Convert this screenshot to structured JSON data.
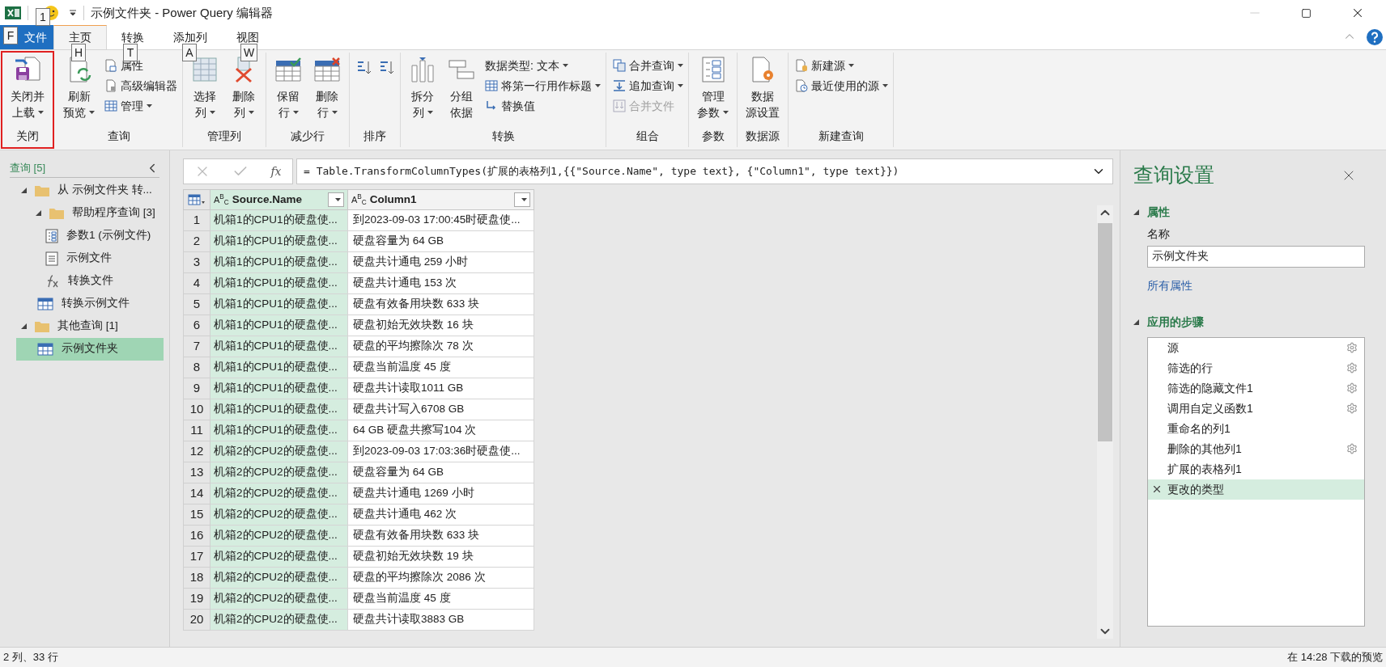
{
  "window": {
    "title": "示例文件夹 - Power Query 编辑器"
  },
  "keytips": [
    {
      "label": "1",
      "kind": "qat"
    },
    {
      "label": "F",
      "kind": "file"
    },
    {
      "label": "H",
      "kind": "home"
    },
    {
      "label": "T",
      "kind": "transform"
    },
    {
      "label": "A",
      "kind": "addcol"
    },
    {
      "label": "W",
      "kind": "view"
    }
  ],
  "tabs": [
    {
      "label": "文件",
      "kind": "file",
      "selected": false
    },
    {
      "label": "主页",
      "kind": "tab",
      "selected": true
    },
    {
      "label": "转换",
      "kind": "tab",
      "selected": false
    },
    {
      "label": "添加列",
      "kind": "tab",
      "selected": false
    },
    {
      "label": "视图",
      "kind": "tab",
      "selected": false
    }
  ],
  "ribbon": [
    {
      "label": "关闭",
      "highlighted": true,
      "items": [
        {
          "kind": "large",
          "lines": [
            "关闭并",
            "上载"
          ],
          "dropdown": true
        }
      ]
    },
    {
      "label": "查询",
      "highlighted": false,
      "items": [
        {
          "kind": "large",
          "lines": [
            "刷新",
            "预览"
          ],
          "dropdown": true
        },
        {
          "kind": "small",
          "label": "属性",
          "dropdown": false,
          "disabled": false
        },
        {
          "kind": "small",
          "label": "高级编辑器",
          "dropdown": false,
          "disabled": false
        },
        {
          "kind": "small",
          "label": "管理",
          "dropdown": true,
          "disabled": false
        }
      ]
    },
    {
      "label": "管理列",
      "highlighted": false,
      "items": [
        {
          "kind": "large",
          "lines": [
            "选择",
            "列"
          ],
          "dropdown": true
        },
        {
          "kind": "large",
          "lines": [
            "删除",
            "列"
          ],
          "dropdown": true
        }
      ]
    },
    {
      "label": "减少行",
      "highlighted": false,
      "items": [
        {
          "kind": "large",
          "lines": [
            "保留",
            "行"
          ],
          "dropdown": true
        },
        {
          "kind": "large",
          "lines": [
            "删除",
            "行"
          ],
          "dropdown": true
        }
      ]
    },
    {
      "label": "排序",
      "highlighted": false,
      "items": [
        {
          "kind": "iconbutton"
        },
        {
          "kind": "iconbutton"
        }
      ]
    },
    {
      "label": "转换",
      "highlighted": false,
      "items": [
        {
          "kind": "large",
          "lines": [
            "拆分",
            "列"
          ],
          "dropdown": true
        },
        {
          "kind": "large",
          "lines": [
            "分组",
            "依据"
          ],
          "dropdown": false
        },
        {
          "kind": "small",
          "label": "数据类型: 文本",
          "dropdown": true,
          "disabled": false
        },
        {
          "kind": "small",
          "label": "将第一行用作标题",
          "dropdown": true,
          "disabled": false
        },
        {
          "kind": "small",
          "label": "替换值",
          "dropdown": false,
          "disabled": false
        }
      ]
    },
    {
      "label": "组合",
      "highlighted": false,
      "items": [
        {
          "kind": "small",
          "label": "合并查询",
          "dropdown": true,
          "disabled": false
        },
        {
          "kind": "small",
          "label": "追加查询",
          "dropdown": true,
          "disabled": false
        },
        {
          "kind": "small",
          "label": "合并文件",
          "dropdown": false,
          "disabled": true
        }
      ]
    },
    {
      "label": "参数",
      "highlighted": false,
      "items": [
        {
          "kind": "large",
          "lines": [
            "管理",
            "参数"
          ],
          "dropdown": true
        }
      ]
    },
    {
      "label": "数据源",
      "highlighted": false,
      "items": [
        {
          "kind": "large",
          "lines": [
            "数据",
            "源设置"
          ],
          "dropdown": false
        }
      ]
    },
    {
      "label": "新建查询",
      "highlighted": false,
      "items": [
        {
          "kind": "small",
          "label": "新建源",
          "dropdown": true,
          "disabled": false
        },
        {
          "kind": "small",
          "label": "最近使用的源",
          "dropdown": true,
          "disabled": false
        }
      ]
    }
  ],
  "queries": {
    "title": "查询 [5]",
    "tree": [
      {
        "label": "从 示例文件夹 转...",
        "kind": "folder",
        "expanded": true,
        "selected": false,
        "children": [
          {
            "label": "帮助程序查询 [3]",
            "kind": "folder",
            "expanded": true,
            "selected": false,
            "children": [
              {
                "label": "参数1 (示例文件)",
                "kind": "parameter",
                "selected": false
              },
              {
                "label": "示例文件",
                "kind": "file",
                "selected": false
              },
              {
                "label": "转换文件",
                "kind": "function",
                "selected": false
              }
            ]
          },
          {
            "label": "转换示例文件",
            "kind": "table",
            "selected": false
          }
        ]
      },
      {
        "label": "其他查询 [1]",
        "kind": "folder",
        "expanded": true,
        "selected": false,
        "children": [
          {
            "label": "示例文件夹",
            "kind": "table",
            "selected": true
          }
        ]
      }
    ]
  },
  "formula_bar": {
    "fx": "fx",
    "formula": "= Table.TransformColumnTypes(扩展的表格列1,{{\"Source.Name\", type text}, {\"Column1\", type text}})"
  },
  "table": {
    "columns": [
      {
        "type": "A$^{B}$$_{C}$",
        "name": "Source.Name",
        "selected": true
      },
      {
        "type": "A$^{B}$$_{C}$",
        "name": "Column1",
        "selected": false
      }
    ],
    "rows": [
      {
        "number": "1",
        "cells": [
          "机箱1的CPU1的硬盘使...",
          "到2023-09-03 17:00:45时硬盘使..."
        ]
      },
      {
        "number": "2",
        "cells": [
          "机箱1的CPU1的硬盘使...",
          "硬盘容量为 64 GB"
        ]
      },
      {
        "number": "3",
        "cells": [
          "机箱1的CPU1的硬盘使...",
          "硬盘共计通电 259 小时"
        ]
      },
      {
        "number": "4",
        "cells": [
          "机箱1的CPU1的硬盘使...",
          "硬盘共计通电 153 次"
        ]
      },
      {
        "number": "5",
        "cells": [
          "机箱1的CPU1的硬盘使...",
          "硬盘有效备用块数 633 块"
        ]
      },
      {
        "number": "6",
        "cells": [
          "机箱1的CPU1的硬盘使...",
          "硬盘初始无效块数 16 块"
        ]
      },
      {
        "number": "7",
        "cells": [
          "机箱1的CPU1的硬盘使...",
          "硬盘的平均擦除次 78 次"
        ]
      },
      {
        "number": "8",
        "cells": [
          "机箱1的CPU1的硬盘使...",
          "硬盘当前温度 45 度"
        ]
      },
      {
        "number": "9",
        "cells": [
          "机箱1的CPU1的硬盘使...",
          "硬盘共计读取1011 GB"
        ]
      },
      {
        "number": "10",
        "cells": [
          "机箱1的CPU1的硬盘使...",
          "硬盘共计写入6708 GB"
        ]
      },
      {
        "number": "11",
        "cells": [
          "机箱1的CPU1的硬盘使...",
          "64 GB 硬盘共擦写104 次"
        ]
      },
      {
        "number": "12",
        "cells": [
          "机箱2的CPU2的硬盘使...",
          "到2023-09-03 17:03:36时硬盘使..."
        ]
      },
      {
        "number": "13",
        "cells": [
          "机箱2的CPU2的硬盘使...",
          "硬盘容量为 64 GB"
        ]
      },
      {
        "number": "14",
        "cells": [
          "机箱2的CPU2的硬盘使...",
          "硬盘共计通电 1269 小时"
        ]
      },
      {
        "number": "15",
        "cells": [
          "机箱2的CPU2的硬盘使...",
          "硬盘共计通电 462 次"
        ]
      },
      {
        "number": "16",
        "cells": [
          "机箱2的CPU2的硬盘使...",
          "硬盘有效备用块数 633 块"
        ]
      },
      {
        "number": "17",
        "cells": [
          "机箱2的CPU2的硬盘使...",
          "硬盘初始无效块数 19 块"
        ]
      },
      {
        "number": "18",
        "cells": [
          "机箱2的CPU2的硬盘使...",
          "硬盘的平均擦除次 2086 次"
        ]
      },
      {
        "number": "19",
        "cells": [
          "机箱2的CPU2的硬盘使...",
          "硬盘当前温度 45 度"
        ]
      },
      {
        "number": "20",
        "cells": [
          "机箱2的CPU2的硬盘使...",
          "硬盘共计读取3883 GB"
        ]
      }
    ]
  },
  "query_settings": {
    "title": "查询设置",
    "properties": {
      "heading": "属性",
      "expanded": true,
      "name_label": "名称",
      "name_value": "示例文件夹",
      "link": "所有属性"
    },
    "steps": {
      "heading": "应用的步骤",
      "expanded": true,
      "items": [
        {
          "name": "源",
          "settings": true,
          "selected": false
        },
        {
          "name": "筛选的行",
          "settings": true,
          "selected": false
        },
        {
          "name": "筛选的隐藏文件1",
          "settings": true,
          "selected": false
        },
        {
          "name": "调用自定义函数1",
          "settings": true,
          "selected": false
        },
        {
          "name": "重命名的列1",
          "settings": false,
          "selected": false
        },
        {
          "name": "删除的其他列1",
          "settings": true,
          "selected": false
        },
        {
          "name": "扩展的表格列1",
          "settings": false,
          "selected": false
        },
        {
          "name": "更改的类型",
          "settings": false,
          "selected": true
        }
      ]
    }
  },
  "status_bar": {
    "left": "2 列、33 行",
    "right": "在 14:28 下载的预览"
  }
}
